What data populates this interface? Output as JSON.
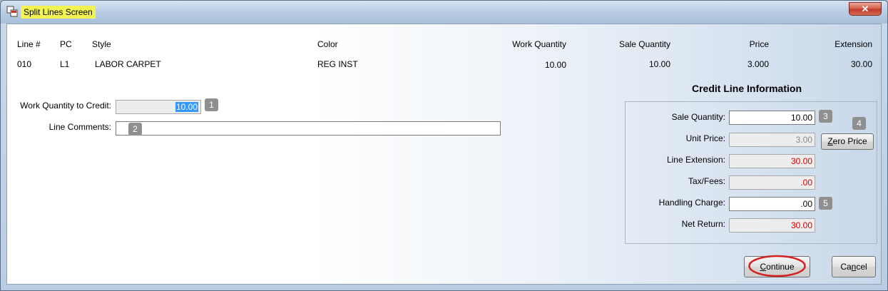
{
  "window": {
    "title": "Split Lines Screen",
    "close_label": "✕"
  },
  "line_table": {
    "headers": {
      "line": "Line #",
      "pc": "PC",
      "style": "Style",
      "color": "Color",
      "work_qty": "Work Quantity",
      "sale_qty": "Sale Quantity",
      "price": "Price",
      "extension": "Extension"
    },
    "row": {
      "line": "010",
      "pc": "L1",
      "style": "LABOR CARPET",
      "color": "REG INST",
      "work_qty": "10.00",
      "sale_qty": "10.00",
      "price": "3.000",
      "extension": "30.00"
    }
  },
  "form": {
    "work_qty_label": "Work Quantity to Credit:",
    "work_qty_value": "10.00",
    "work_qty_badge": "1",
    "comments_label": "Line Comments:",
    "comments_value": "",
    "comments_badge": "2"
  },
  "credit_info": {
    "title": "Credit Line Information",
    "sale_qty_label": "Sale Quantity:",
    "sale_qty_value": "10.00",
    "sale_qty_badge": "3",
    "zero_price_badge": "4",
    "zero_price_label_u": "Z",
    "zero_price_label_rest": "ero Price",
    "unit_price_label": "Unit Price:",
    "unit_price_value": "3.00",
    "line_ext_label": "Line Extension:",
    "line_ext_value": "30.00",
    "tax_label": "Tax/Fees:",
    "tax_value": ".00",
    "handling_label": "Handling Charge:",
    "handling_value": ".00",
    "handling_badge": "5",
    "net_return_label": "Net Return:",
    "net_return_value": "30.00"
  },
  "buttons": {
    "continue_u": "C",
    "continue_rest": "ontinue",
    "cancel_pre": "Ca",
    "cancel_u": "n",
    "cancel_post": "cel"
  },
  "colors": {
    "highlight_circle": "#d42020",
    "value_red": "#d80000",
    "title_highlight": "#f2f252"
  }
}
